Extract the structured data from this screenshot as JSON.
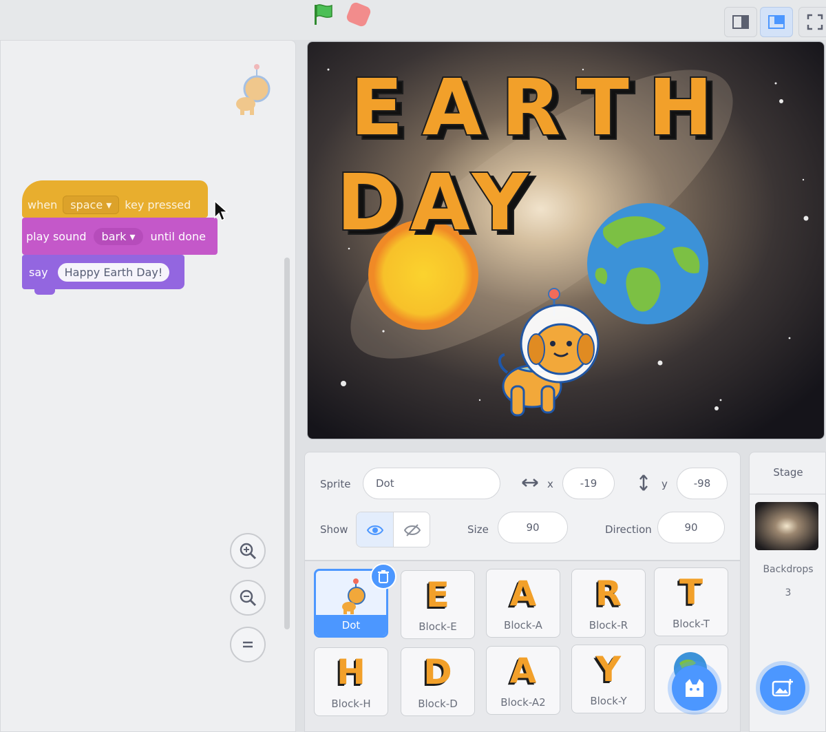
{
  "toolbar": {
    "green_flag_icon": "green-flag-icon",
    "stop_icon": "stop-icon",
    "small_stage_icon": "small-stage-icon",
    "large_stage_icon": "large-stage-icon",
    "fullscreen_icon": "fullscreen-icon"
  },
  "code": {
    "hat_block": {
      "prefix": "when",
      "key_option": "space",
      "suffix": "key pressed",
      "color": "#e8ae2e"
    },
    "sound_block": {
      "prefix": "play sound",
      "sound_option": "bark",
      "suffix": "until done",
      "color": "#c458c9"
    },
    "say_block": {
      "prefix": "say",
      "message": "Happy Earth Day!",
      "color": "#9366e0"
    },
    "zoom_in_icon": "zoom-in-icon",
    "zoom_out_icon": "zoom-out-icon",
    "zoom_reset_icon": "zoom-reset-icon"
  },
  "stage": {
    "title_line1": "EARTH",
    "title_line2": "DAY"
  },
  "sprite_info": {
    "sprite_label": "Sprite",
    "sprite_name": "Dot",
    "x_label": "x",
    "x_value": "-19",
    "y_label": "y",
    "y_value": "-98",
    "show_label": "Show",
    "size_label": "Size",
    "size_value": "90",
    "direction_label": "Direction",
    "direction_value": "90"
  },
  "sprites": [
    {
      "name": "Dot",
      "selected": true
    },
    {
      "name": "Block-E",
      "glyph": "E"
    },
    {
      "name": "Block-A",
      "glyph": "A"
    },
    {
      "name": "Block-R",
      "glyph": "R"
    },
    {
      "name": "Block-T",
      "glyph": "T"
    },
    {
      "name": "Block-H",
      "glyph": "H"
    },
    {
      "name": "Block-D",
      "glyph": "D"
    },
    {
      "name": "Block-A2",
      "glyph": "A"
    },
    {
      "name": "Block-Y",
      "glyph": "Y"
    },
    {
      "name": ""
    }
  ],
  "stage_pane": {
    "title": "Stage",
    "backdrops_label": "Backdrops",
    "backdrops_count": "3"
  },
  "colors": {
    "accent": "#4c97ff",
    "events": "#e8ae2e",
    "sound": "#c458c9",
    "looks": "#9366e0"
  }
}
